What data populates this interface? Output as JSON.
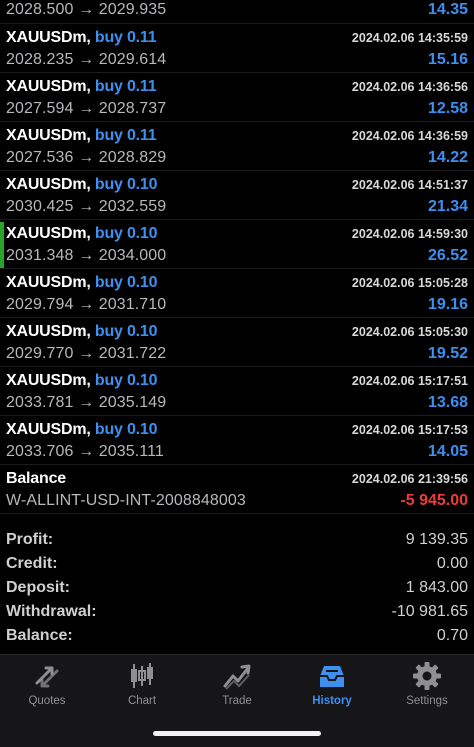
{
  "history": {
    "top_row": {
      "prices": "2028.500 → 2029.935",
      "profit": "14.35"
    },
    "deals": [
      {
        "symbol": "XAUUSDm",
        "side": "buy 0.11",
        "date": "2024.02.06 14:35:59",
        "prices": "2028.235 → 2029.614",
        "profit": "15.16"
      },
      {
        "symbol": "XAUUSDm",
        "side": "buy 0.11",
        "date": "2024.02.06 14:36:56",
        "prices": "2027.594 → 2028.737",
        "profit": "12.58"
      },
      {
        "symbol": "XAUUSDm",
        "side": "buy 0.11",
        "date": "2024.02.06 14:36:59",
        "prices": "2027.536 → 2028.829",
        "profit": "14.22"
      },
      {
        "symbol": "XAUUSDm",
        "side": "buy 0.10",
        "date": "2024.02.06 14:51:37",
        "prices": "2030.425 → 2032.559",
        "profit": "21.34"
      },
      {
        "symbol": "XAUUSDm",
        "side": "buy 0.10",
        "date": "2024.02.06 14:59:30",
        "prices": "2031.348 → 2034.000",
        "profit": "26.52"
      },
      {
        "symbol": "XAUUSDm",
        "side": "buy 0.10",
        "date": "2024.02.06 15:05:28",
        "prices": "2029.794 → 2031.710",
        "profit": "19.16"
      },
      {
        "symbol": "XAUUSDm",
        "side": "buy 0.10",
        "date": "2024.02.06 15:05:30",
        "prices": "2029.770 → 2031.722",
        "profit": "19.52"
      },
      {
        "symbol": "XAUUSDm",
        "side": "buy 0.10",
        "date": "2024.02.06 15:17:51",
        "prices": "2033.781 → 2035.149",
        "profit": "13.68"
      },
      {
        "symbol": "XAUUSDm",
        "side": "buy 0.10",
        "date": "2024.02.06 15:17:53",
        "prices": "2033.706 → 2035.111",
        "profit": "14.05"
      }
    ],
    "balance_entry": {
      "title": "Balance",
      "date": "2024.02.06 21:39:56",
      "comment": "W-ALLINT-USD-INT-2008848003",
      "amount": "-5 945.00"
    }
  },
  "summary": {
    "profit_label": "Profit:",
    "profit": "9 139.35",
    "credit_label": "Credit:",
    "credit": "0.00",
    "deposit_label": "Deposit:",
    "deposit": "1 843.00",
    "withdrawal_label": "Withdrawal:",
    "withdrawal": "-10 981.65",
    "balance_label": "Balance:",
    "balance": "0.70"
  },
  "tabs": [
    {
      "label": "Quotes",
      "icon": "quotes-arrows-icon"
    },
    {
      "label": "Chart",
      "icon": "candlestick-chart-icon"
    },
    {
      "label": "Trade",
      "icon": "trade-chart-icon"
    },
    {
      "label": "History",
      "icon": "history-tray-icon",
      "active": true
    },
    {
      "label": "Settings",
      "icon": "gear-icon"
    }
  ],
  "colors": {
    "profit_positive": "#3d8ff0",
    "profit_negative": "#f03a3a",
    "active_tab": "#3d8ff0",
    "marker": "#29a329"
  }
}
